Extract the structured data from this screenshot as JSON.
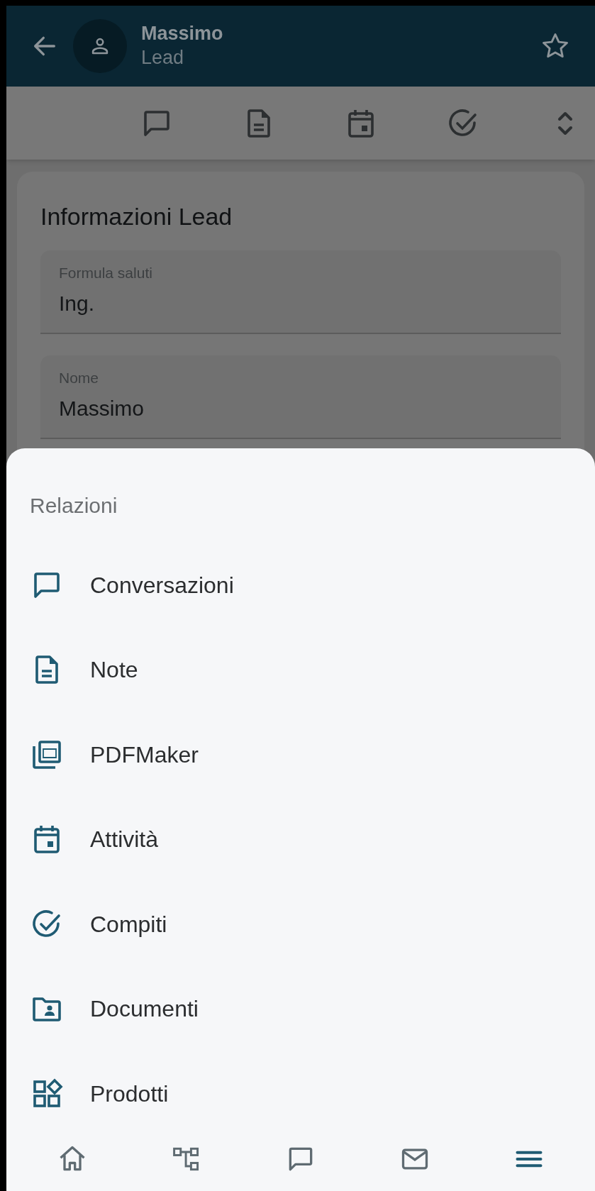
{
  "header": {
    "title": "Massimo",
    "subtitle": "Lead"
  },
  "toolbar": [
    {
      "kind": "chat"
    },
    {
      "kind": "note"
    },
    {
      "kind": "calendar"
    },
    {
      "kind": "check"
    },
    {
      "kind": "expand"
    }
  ],
  "card": {
    "title": "Informazioni Lead",
    "fields": [
      {
        "label": "Formula saluti",
        "value": "Ing."
      },
      {
        "label": "Nome",
        "value": "Massimo"
      }
    ]
  },
  "sheet": {
    "title": "Relazioni",
    "items": [
      {
        "label": "Conversazioni",
        "kind": "chat"
      },
      {
        "label": "Note",
        "kind": "note"
      },
      {
        "label": "PDFMaker",
        "kind": "pdf"
      },
      {
        "label": "Attività",
        "kind": "calendar"
      },
      {
        "label": "Compiti",
        "kind": "check"
      },
      {
        "label": "Documenti",
        "kind": "folder"
      },
      {
        "label": "Prodotti",
        "kind": "grid"
      }
    ]
  },
  "bottom_nav": [
    {
      "kind": "home",
      "selected": false
    },
    {
      "kind": "tree",
      "selected": false
    },
    {
      "kind": "chat",
      "selected": false
    },
    {
      "kind": "mail",
      "selected": false
    },
    {
      "kind": "menu",
      "selected": true
    }
  ]
}
